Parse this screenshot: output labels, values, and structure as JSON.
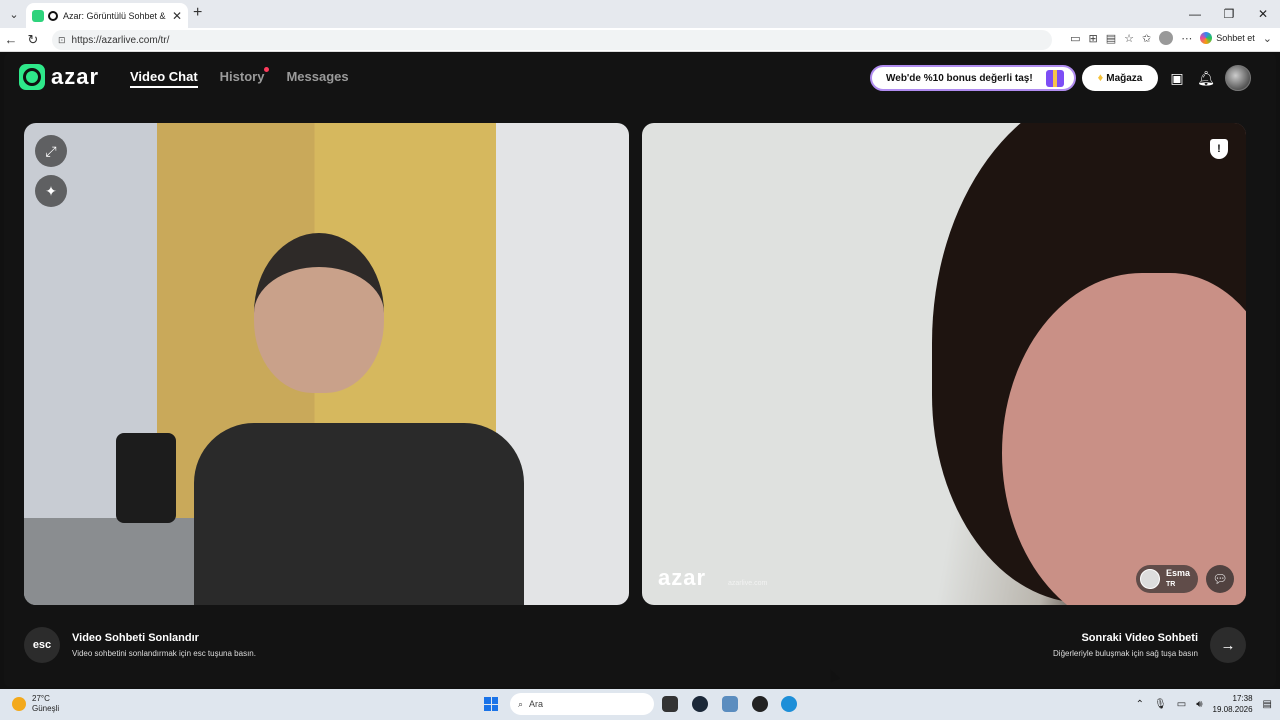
{
  "browser": {
    "tab_title": "Azar: Görüntülü Sohbet & Ye",
    "url": "https://azarlive.com/tr/",
    "copilot_label": "Sohbet et"
  },
  "app": {
    "logo_text": "azar",
    "nav": {
      "video_chat": "Video Chat",
      "history": "History",
      "messages": "Messages"
    },
    "promo_text": "Web'de %10 bonus değerli taş!",
    "store_label": "Mağaza"
  },
  "video": {
    "watermark": "azar",
    "watermark_sub": "azarlive.com",
    "peer": {
      "name": "Esma",
      "country": "TR"
    }
  },
  "actions": {
    "esc_key": "esc",
    "end_title": "Video Sohbeti Sonlandır",
    "end_sub": "Video sohbetini sonlandırmak için esc tuşuna basın.",
    "next_title": "Sonraki Video Sohbeti",
    "next_sub": "Diğerleriyle buluşmak için sağ tuşa basın"
  },
  "taskbar": {
    "temperature": "27°C",
    "weather": "Güneşli",
    "search_placeholder": "Ara",
    "time": "17:38",
    "date": "19.08.2026"
  },
  "colors": {
    "brand_green": "#2ee88a",
    "notify_red": "#ff3b5c",
    "promo_purple": "#7d4df5"
  }
}
